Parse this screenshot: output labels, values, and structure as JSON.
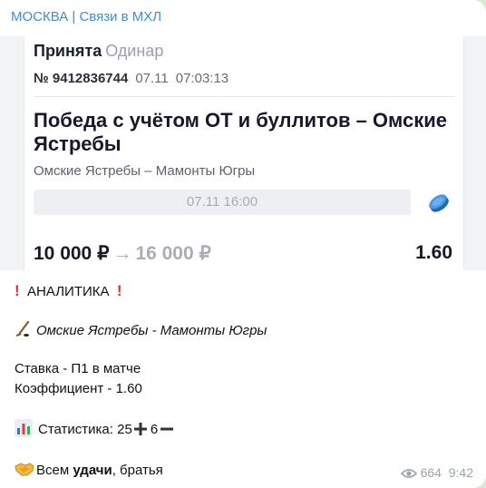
{
  "channel": "МОСКВА | Связи в МХЛ",
  "bet": {
    "status": "Принята",
    "type": "Одинар",
    "number": "№ 9412836744",
    "date": "07.11",
    "time": "07:03:13",
    "market": "Победа с учётом ОТ и буллитов – Омские Ястребы",
    "teams": "Омские Ястребы – Мамонты Югры",
    "match_time": "07.11 16:00",
    "stake": "10 000 ₽",
    "arrow": "→",
    "win": "16 000 ₽",
    "odds": "1.60"
  },
  "message": {
    "analytics": "АНАЛИТИКА",
    "match": "Омские Ястребы - Мамонты Югры",
    "bet_line": "Ставка - П1 в матче",
    "coef_line": "Коэффициент - 1.60",
    "stats_label": "Статистика:",
    "stats_wins": "25",
    "stats_losses": "6",
    "luck_a": "Всем ",
    "luck_b": "удачи",
    "luck_c": ", братья"
  },
  "meta": {
    "views": "664",
    "time": "9:42"
  },
  "colors": {
    "link": "#3f8fcc",
    "puck": "#2f7fd0",
    "excl": "#e0302f"
  },
  "icons": [
    "hockey-icon",
    "bar-chart-icon",
    "plus-icon",
    "minus-icon",
    "handshake-icon",
    "eye-icon",
    "puck-icon"
  ]
}
